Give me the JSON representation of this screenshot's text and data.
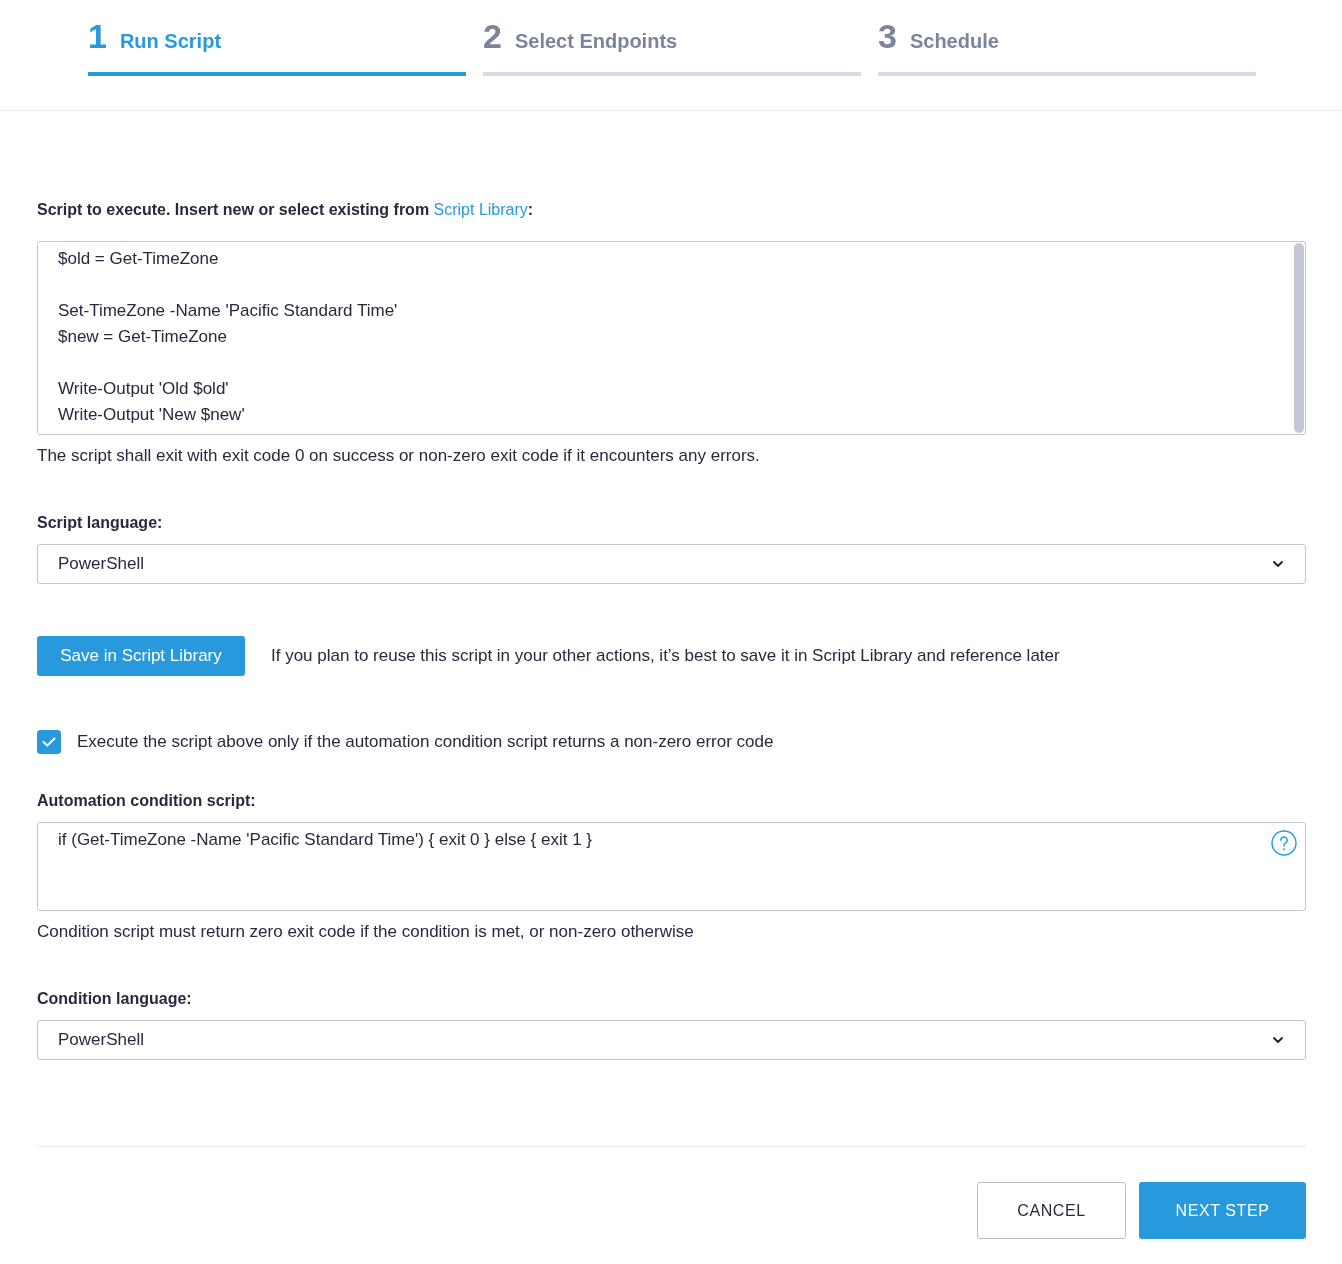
{
  "steps": [
    {
      "number": "1",
      "label": "Run Script",
      "selected": true
    },
    {
      "number": "2",
      "label": "Select Endpoints",
      "selected": false
    },
    {
      "number": "3",
      "label": "Schedule",
      "selected": false
    }
  ],
  "script": {
    "prompt_before": "Script to execute. Insert new or select existing from ",
    "prompt_link": "Script Library",
    "prompt_after": ":",
    "code": "$old = Get-TimeZone\n\nSet-TimeZone -Name 'Pacific Standard Time'\n$new = Get-TimeZone\n\nWrite-Output 'Old $old'\nWrite-Output 'New $new'",
    "hint": "The script shall exit with exit code 0 on success or non-zero exit code if it encounters any errors."
  },
  "script_language": {
    "label": "Script language:",
    "value": "PowerShell"
  },
  "save": {
    "button": "Save in Script Library",
    "note": "If you plan to reuse this script in your other actions, it’s best to save it in Script Library and reference later"
  },
  "condition_toggle": {
    "checked": true,
    "label": "Execute the script above only if the automation condition script returns a non-zero error code"
  },
  "condition_script": {
    "label": "Automation condition script:",
    "code": "if (Get-TimeZone -Name 'Pacific Standard Time') { exit 0 } else { exit 1 }",
    "hint": "Condition script must return zero exit code if the condition is met, or non-zero otherwise"
  },
  "condition_language": {
    "label": "Condition language:",
    "value": "PowerShell"
  },
  "buttons": [
    {
      "label": "CANCEL",
      "kind": "secondary"
    },
    {
      "label": "NEXT STEP",
      "kind": "primary"
    }
  ]
}
